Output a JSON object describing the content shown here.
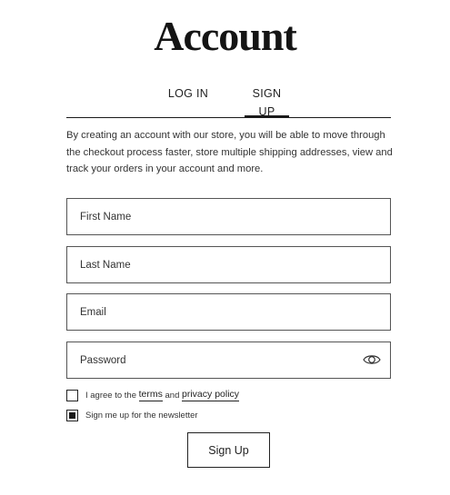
{
  "page": {
    "title": "Account"
  },
  "tabs": [
    {
      "label": "LOG IN",
      "active": false
    },
    {
      "label": "SIGN UP",
      "active": true
    }
  ],
  "intro_text": "By creating an account with our store, you will be able to move through the checkout process faster, store multiple shipping addresses, view and track your orders in your account and more.",
  "form": {
    "first_name": {
      "value": "",
      "placeholder": "First Name"
    },
    "last_name": {
      "value": "",
      "placeholder": "Last Name"
    },
    "email": {
      "value": "",
      "placeholder": "Email"
    },
    "password": {
      "value": "",
      "placeholder": "Password",
      "toggle_icon": "eye-icon"
    },
    "terms": {
      "prefix": "I agree to the ",
      "terms_link": "terms",
      "middle": " and ",
      "privacy_link": "privacy policy",
      "checked": false
    },
    "newsletter": {
      "label": "Sign me up for the newsletter",
      "checked": true
    },
    "submit_label": "Sign Up"
  },
  "colors": {
    "text": "#222222",
    "border": "#555555",
    "accent": "#1a1a1a",
    "background": "#ffffff"
  }
}
